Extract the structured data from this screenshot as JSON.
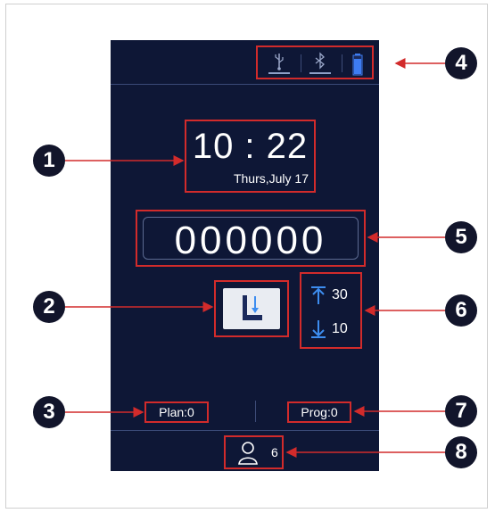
{
  "status_bar": {
    "icons": [
      {
        "name": "usb-icon",
        "color": "#9aa7c9"
      },
      {
        "name": "bluetooth-icon",
        "color": "#9aa7c9"
      },
      {
        "name": "battery-icon",
        "color": "#3d7cf2"
      }
    ]
  },
  "clock": {
    "time": "10 : 22",
    "date": "Thurs,July 17"
  },
  "counter": {
    "value": "000000"
  },
  "pedal_button": {
    "icon": "foot-pedal-down-icon"
  },
  "limits": {
    "upper": "30",
    "lower": "10",
    "accent": "#3d8df0"
  },
  "plan": {
    "label": "Plan:0"
  },
  "prog": {
    "label": "Prog:0"
  },
  "operator": {
    "icon": "person-icon",
    "count": "6"
  },
  "callouts": [
    "1",
    "2",
    "3",
    "4",
    "5",
    "6",
    "7",
    "8"
  ],
  "colors": {
    "screen_bg": "#0e1736",
    "highlight": "#d22b2b",
    "callout_bg": "#12152b"
  }
}
